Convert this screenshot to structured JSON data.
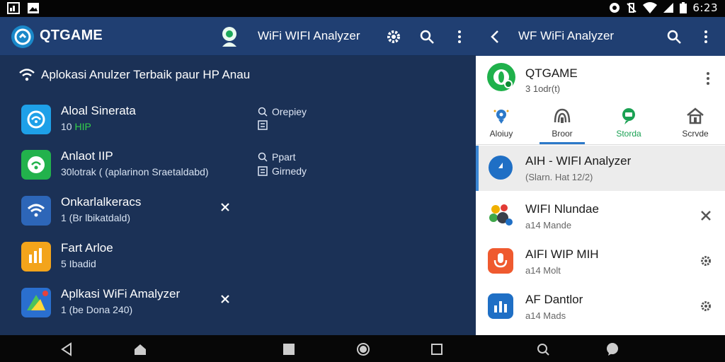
{
  "status_bar": {
    "left_icons": [
      "gallery-icon",
      "photo-icon"
    ],
    "right_icons": [
      "alarm-icon",
      "vibrate-icon",
      "wifi-icon",
      "signal-icon",
      "battery-icon"
    ],
    "time": "6:23"
  },
  "left_panel": {
    "app_title": "QTGAME",
    "center_title": "WiFi WIFI Analyzer",
    "actions": [
      "settings-icon",
      "search-icon",
      "more-vert-icon"
    ],
    "section_title": "Aplokasi Anulzer Terbaik paur HP Anau",
    "items": [
      {
        "title": "Aloal Sinerata",
        "subtitle": "10 ",
        "subtitle_green": "HIP",
        "side_1": "Orepiey",
        "side_1_icon": "search-icon",
        "side_2": "",
        "side_2_icon": "code-icon",
        "icon_color": "#1ea0e8",
        "icon": "wifi-circle-icon"
      },
      {
        "title": "Anlaot IIP",
        "subtitle": "30lotrak ( (aplarinon Sraetaldabd)",
        "subtitle_green": "",
        "side_1": "Ppart",
        "side_1_icon": "search-icon",
        "side_2": "Girnedy",
        "side_2_icon": "code-icon",
        "icon_color": "#22b24c",
        "icon": "wifi-badge-icon"
      },
      {
        "title": "Onkarlalkeracs",
        "subtitle": "1",
        "subtitle_green": "",
        "subtitle_rest": " (Br lbikatdald)",
        "close": true,
        "icon_color": "#2d66b8",
        "icon": "wifi-icon"
      },
      {
        "title": "Fart Arloe",
        "subtitle": "5",
        "subtitle_green": "",
        "subtitle_rest": " Ibadid",
        "icon_color": "#f3a41b",
        "icon": "signal-bars-icon"
      },
      {
        "title": "Aplkasi WiFi Amalyzer",
        "subtitle": "1",
        "subtitle_green": "",
        "subtitle_rest": " (be Dona 240)",
        "close": true,
        "icon_color": "#2a6fcf",
        "icon": "maps-icon"
      }
    ]
  },
  "right_panel": {
    "title": "WF WiFi Analyzer",
    "header": {
      "title": "QTGAME",
      "subtitle": "3 1odr(t)"
    },
    "tabs": [
      {
        "label": "Aloiuy",
        "icon": "location-icon",
        "active": false
      },
      {
        "label": "Broor",
        "icon": "speed-icon",
        "active": true
      },
      {
        "label": "Storda",
        "icon": "chat-icon",
        "active": false,
        "color": "#1aa153"
      },
      {
        "label": "Scrvde",
        "icon": "house-icon",
        "active": false
      }
    ],
    "items": [
      {
        "title": "AIH - WIFI Analyzer",
        "subtitle": "(Slarn. Hat 12/2)",
        "selected": true,
        "icon": "compass-icon",
        "action": ""
      },
      {
        "title": "WIFI Nlundae",
        "subtitle": "a14 Mande",
        "selected": false,
        "icon": "color-dots-icon",
        "action": "close-icon"
      },
      {
        "title": "AIFI WIP MIH",
        "subtitle": "a14 Molt",
        "selected": false,
        "icon": "mic-icon",
        "action": "settings-icon"
      },
      {
        "title": "AF Dantlor",
        "subtitle": "a14 Mads",
        "selected": false,
        "icon": "bar-chart-icon",
        "action": "settings-icon"
      }
    ]
  },
  "nav_bar": {
    "icons": [
      "back-icon",
      "home-icon",
      "square-icon",
      "record-icon",
      "recents-icon",
      "search-icon",
      "chat-icon"
    ]
  }
}
